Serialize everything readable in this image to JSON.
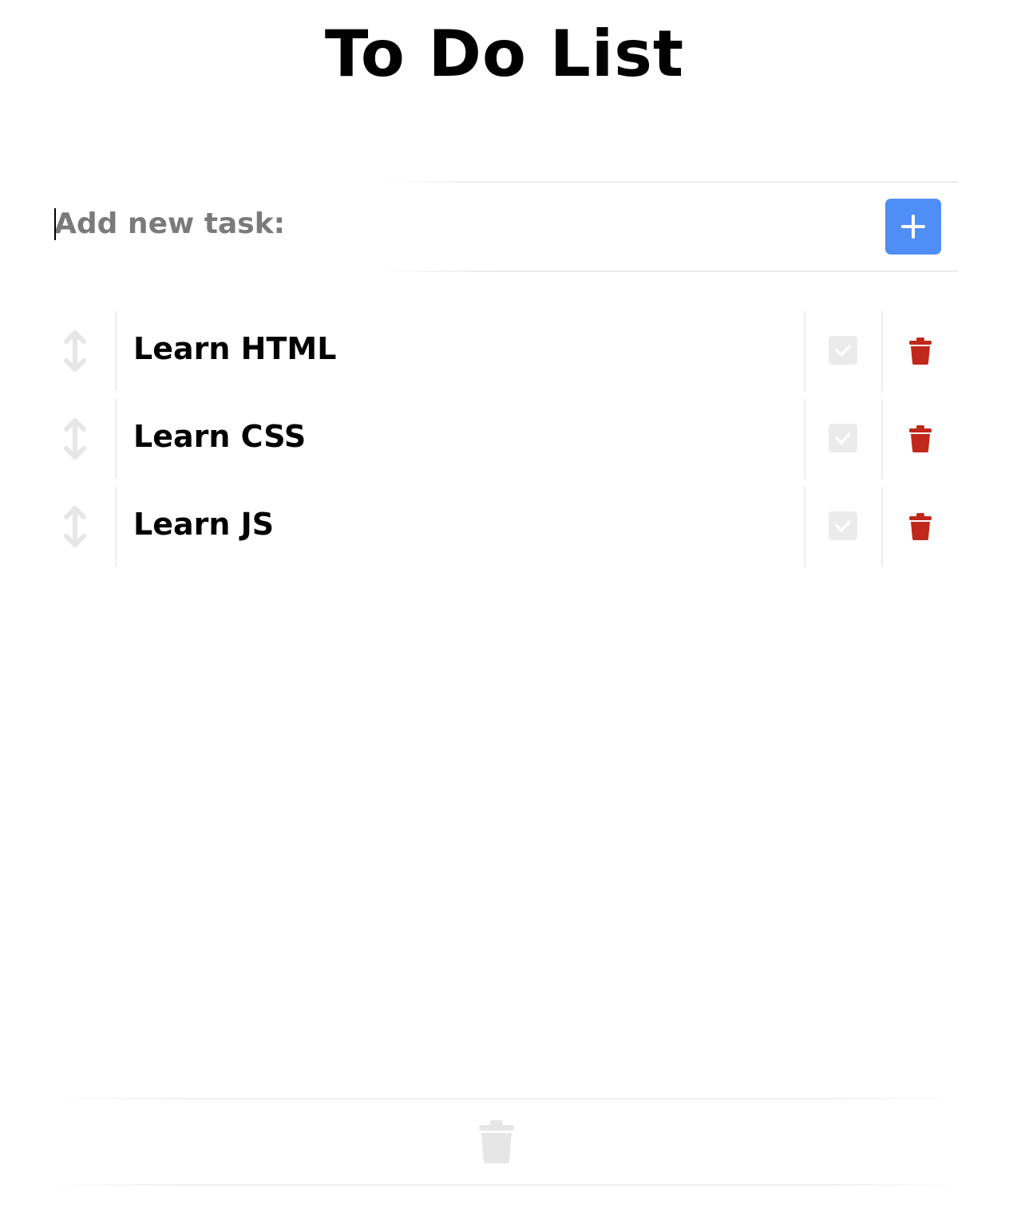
{
  "header": {
    "title": "To Do List"
  },
  "add_task": {
    "placeholder": "Add new task:",
    "value": "",
    "button_icon": "plus-icon",
    "button_color": "#4f8ef7"
  },
  "tasks": [
    {
      "label": "Learn HTML",
      "done": false
    },
    {
      "label": "Learn CSS",
      "done": false
    },
    {
      "label": "Learn JS",
      "done": false
    }
  ],
  "icons": {
    "drag": "up-down-arrow-icon",
    "complete": "check-icon",
    "delete": "trash-icon",
    "delete_color": "#c0281c",
    "muted_color": "#e6e6e6"
  },
  "footer": {
    "icon": "trash-icon"
  }
}
